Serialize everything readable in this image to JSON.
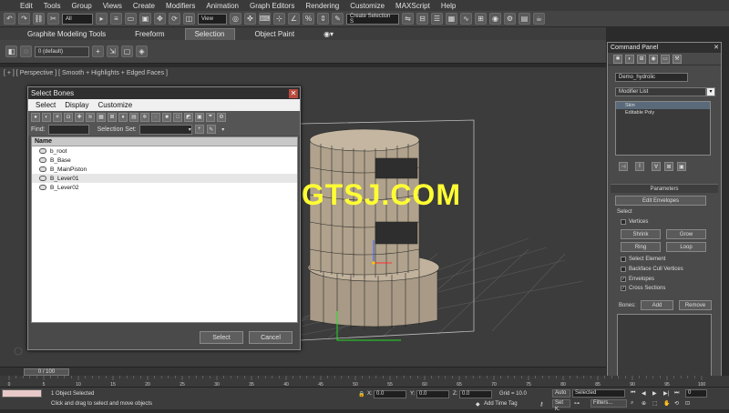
{
  "menubar": [
    "Edit",
    "Tools",
    "Group",
    "Views",
    "Create",
    "Modifiers",
    "Animation",
    "Graph Editors",
    "Rendering",
    "Customize",
    "MAXScript",
    "Help"
  ],
  "toolbar": {
    "filter_value": "All",
    "refcoord_value": "View",
    "named_selection_placeholder": "Create Selection S"
  },
  "ribbon": {
    "tabs": [
      "Graphite Modeling Tools",
      "Freeform",
      "Selection",
      "Object Paint"
    ],
    "active_tab": "Selection",
    "layer_value": "0 (default)"
  },
  "viewport": {
    "label": "[ + ] [ Perspective ] [ Smooth + Highlights + Edged Faces ]"
  },
  "watermark": "WWW.CGTSJ.COM",
  "dialog": {
    "title": "Select Bones",
    "menus": [
      "Select",
      "Display",
      "Customize"
    ],
    "find_label": "Find:",
    "selection_set_label": "Selection Set:",
    "list_header": "Name",
    "bones": [
      "b_root",
      "B_Base",
      "B_MainPiston",
      "B_Lever01",
      "B_Lever02"
    ],
    "select_button": "Select",
    "cancel_button": "Cancel"
  },
  "command_panel": {
    "title": "Command Panel",
    "object_name": "Demo_hydrolic",
    "modifier_list": "Modifier List",
    "stack": [
      "Skin",
      "Editable Poly"
    ],
    "rollout_title": "Parameters",
    "edit_envelopes": "Edit Envelopes",
    "select_label": "Select",
    "vertices": "Vertices",
    "shrink": "Shrink",
    "grow": "Grow",
    "ring": "Ring",
    "loop": "Loop",
    "select_element": "Select Element",
    "backface_cull": "Backface Cull Vertices",
    "envelopes": "Envelopes",
    "cross_sections": "Cross Sections",
    "bones_label": "Bones:",
    "add": "Add",
    "remove": "Remove"
  },
  "timeline": {
    "slider": "0 / 100",
    "ticks": [
      "0",
      "5",
      "10",
      "15",
      "20",
      "25",
      "30",
      "35",
      "40",
      "45",
      "50",
      "55",
      "60",
      "65",
      "70",
      "75",
      "80",
      "85",
      "90",
      "95",
      "100"
    ]
  },
  "status": {
    "objects_selected": "1 Object Selected",
    "prompt": "Click and drag to select and move objects",
    "x_label": "X:",
    "x_value": "0.0",
    "y_label": "Y:",
    "y_value": "0.0",
    "z_label": "Z:",
    "z_value": "0.0",
    "grid": "Grid = 10.0",
    "add_time_tag": "Add Time Tag",
    "auto": "Auto",
    "selected": "Selected",
    "set_key": "Set K.",
    "filters": "Filters...",
    "frame": "0"
  }
}
